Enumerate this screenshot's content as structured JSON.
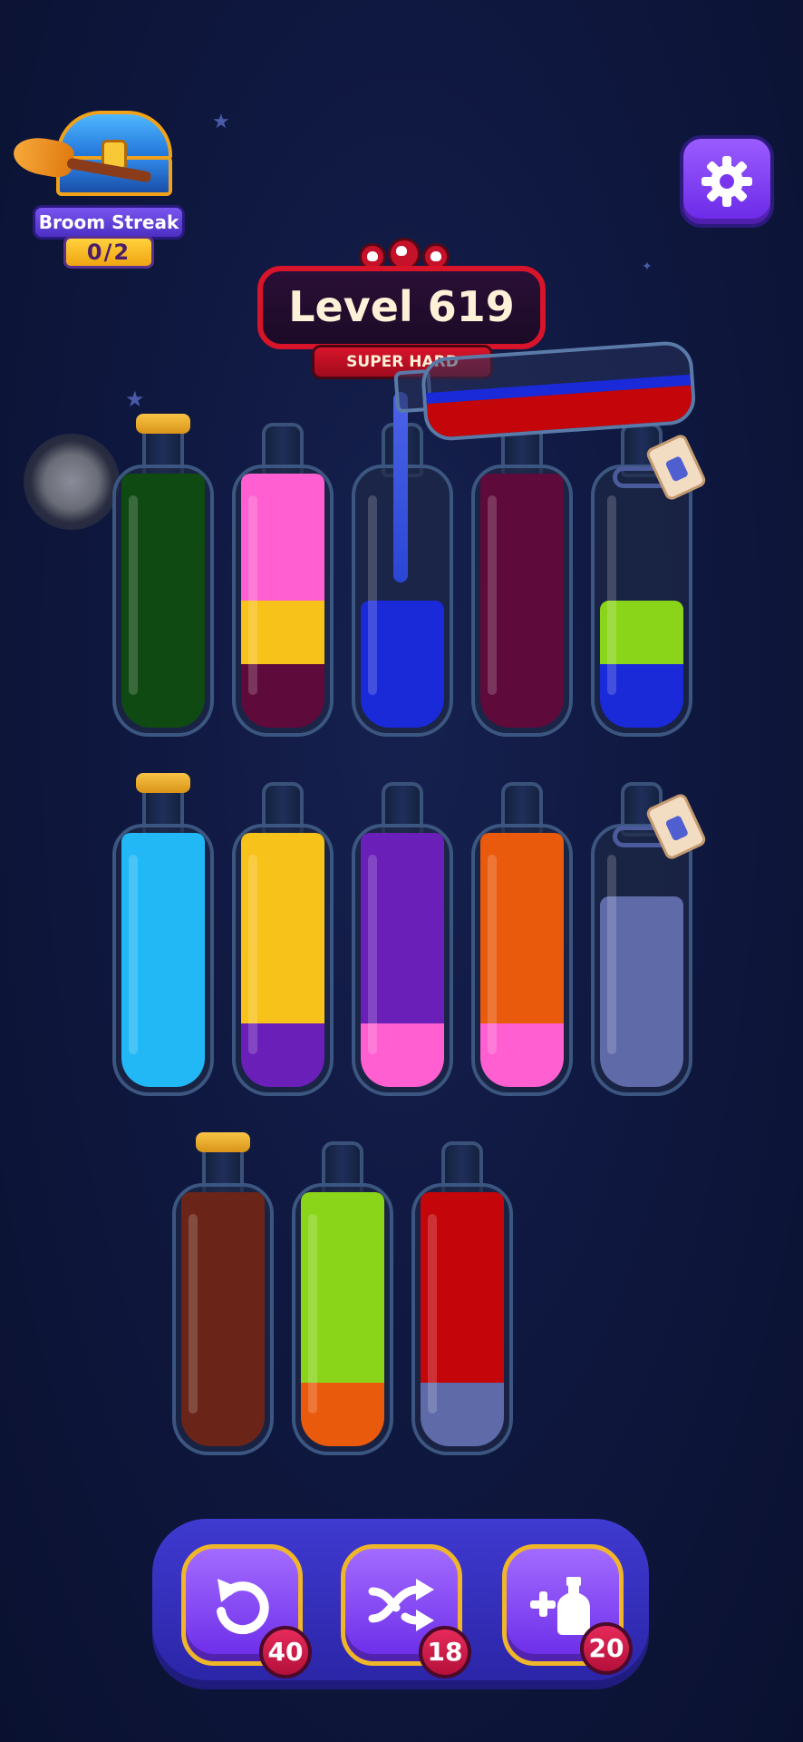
{
  "streak": {
    "label": "Broom Streak",
    "count": "0/2"
  },
  "level": {
    "title": "Level 619",
    "difficulty": "SUPER HARD"
  },
  "colors": {
    "green": "#0f4a12",
    "pink": "#ff5fd0",
    "yellow": "#f7c21a",
    "maroon": "#5e0a3a",
    "blue": "#1a2ad8",
    "lime": "#8ad51a",
    "cyan": "#22b8f5",
    "purple": "#6a1fb8",
    "orange": "#e95a0c",
    "lavender": "#5f6aa8",
    "brown": "#6a2418",
    "red": "#c4060a"
  },
  "bottles": [
    {
      "row": 1,
      "segments": [
        "green",
        "green",
        "green",
        "green"
      ],
      "cork": true
    },
    {
      "row": 1,
      "segments": [
        "pink",
        "pink",
        "yellow",
        "maroon"
      ]
    },
    {
      "row": 1,
      "segments": [
        "blue",
        "blue"
      ]
    },
    {
      "row": 1,
      "segments": [
        "maroon",
        "maroon",
        "maroon",
        "maroon"
      ]
    },
    {
      "row": 1,
      "segments": [
        "lime",
        "blue"
      ],
      "tagged": true
    },
    {
      "row": 2,
      "segments": [
        "cyan",
        "cyan",
        "cyan",
        "cyan"
      ],
      "cork": true
    },
    {
      "row": 2,
      "segments": [
        "yellow",
        "yellow",
        "yellow",
        "purple"
      ]
    },
    {
      "row": 2,
      "segments": [
        "purple",
        "purple",
        "purple",
        "pink"
      ]
    },
    {
      "row": 2,
      "segments": [
        "orange",
        "orange",
        "orange",
        "pink"
      ]
    },
    {
      "row": 2,
      "segments": [
        "lavender",
        "lavender",
        "lavender"
      ],
      "tagged": true
    },
    {
      "row": 3,
      "segments": [
        "brown",
        "brown",
        "brown",
        "brown"
      ],
      "cork": true
    },
    {
      "row": 3,
      "segments": [
        "lime",
        "lime",
        "lime",
        "orange"
      ]
    },
    {
      "row": 3,
      "segments": [
        "red",
        "red",
        "red",
        "lavender"
      ]
    }
  ],
  "pouring": {
    "segments": [
      "blue",
      "red"
    ]
  },
  "tools": {
    "undo": {
      "icon": "undo-icon",
      "count": "40"
    },
    "shuffle": {
      "icon": "shuffle-icon",
      "count": "18"
    },
    "add_bottle": {
      "icon": "add-bottle-icon",
      "count": "20"
    }
  }
}
